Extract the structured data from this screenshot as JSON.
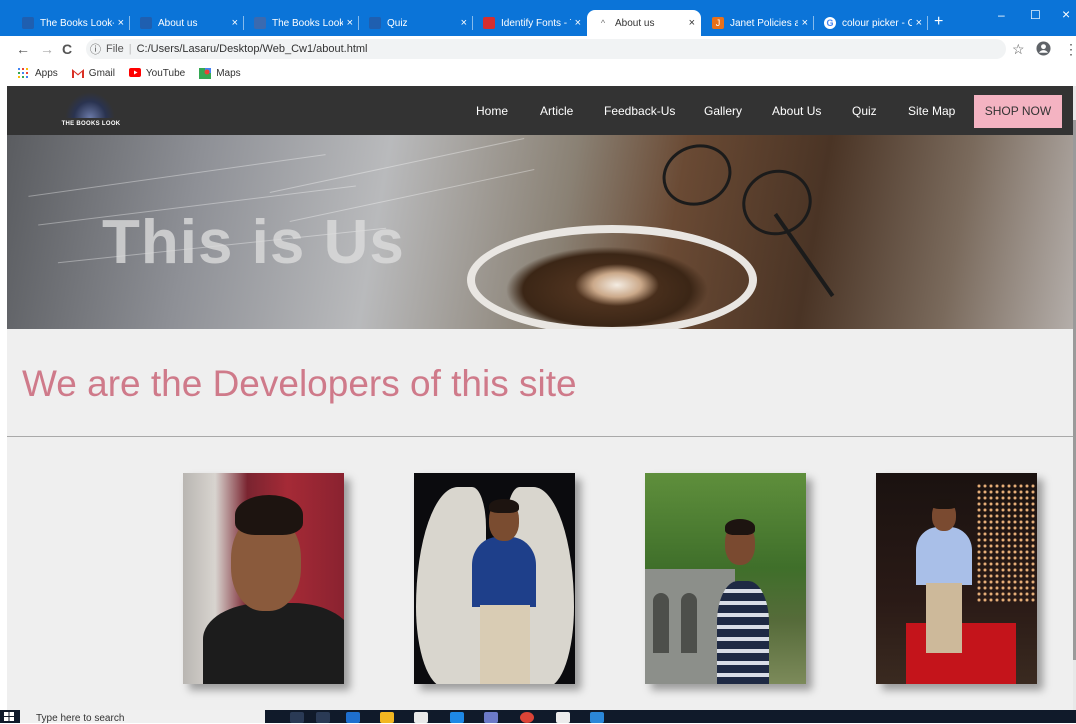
{
  "browser": {
    "tabs": [
      {
        "label": "The Books Look-H",
        "close": "×",
        "active": false,
        "favicon_color": "#1f5fb0"
      },
      {
        "label": "About us",
        "close": "×",
        "active": false,
        "favicon_color": "#1f5fb0"
      },
      {
        "label": "The Books Look-H",
        "close": "×",
        "active": false,
        "favicon_color": "#3a6ab0"
      },
      {
        "label": "Quiz",
        "close": "×",
        "active": false,
        "favicon_color": "#1f5fb0"
      },
      {
        "label": "Identify Fonts - Th",
        "close": "×",
        "active": false,
        "favicon_color": "#d62e2e"
      },
      {
        "label": "About us",
        "close": "×",
        "active": true,
        "favicon_color": "#9aa0a6"
      },
      {
        "label": "Janet Policies and",
        "close": "×",
        "active": false,
        "favicon_color": "#e8701a"
      },
      {
        "label": "colour picker - Go",
        "close": "×",
        "active": false,
        "favicon_color": "#ffffff"
      }
    ],
    "new_tab": "+",
    "window_controls": {
      "minimize": "–",
      "maximize": "☐",
      "close": "×"
    },
    "nav": {
      "back": "←",
      "forward": "→",
      "reload": "C"
    },
    "address": {
      "info_icon": "ⓘ",
      "scheme": "File",
      "divider": "|",
      "url": "C:/Users/Lasaru/Desktop/Web_Cw1/about.html"
    },
    "star": "☆",
    "kebab": "⋮",
    "bookmarks": [
      {
        "label": "Apps",
        "icon": "apps-grid-icon",
        "color": "#e8453c"
      },
      {
        "label": "Gmail",
        "icon": "gmail-icon",
        "color": "#d93025"
      },
      {
        "label": "YouTube",
        "icon": "youtube-icon",
        "color": "#ff0000"
      },
      {
        "label": "Maps",
        "icon": "maps-icon",
        "color": "#34a853"
      }
    ]
  },
  "site": {
    "logo_text": "THE BOOKS LOOK",
    "nav": [
      "Home",
      "Article",
      "Feedback-Us",
      "Gallery",
      "About Us",
      "Quiz",
      "Site Map"
    ],
    "shop_button": "SHOP NOW",
    "hero_title": "This is Us",
    "section_title": "We are the Developers of this site",
    "accent_color": "#cf7a8a",
    "shop_color": "#f4b3c2",
    "developers": [
      {
        "photo": "developer-photo-1"
      },
      {
        "photo": "developer-photo-2"
      },
      {
        "photo": "developer-photo-3"
      },
      {
        "photo": "developer-photo-4"
      }
    ]
  },
  "taskbar": {
    "search_placeholder": "Type here to search"
  }
}
